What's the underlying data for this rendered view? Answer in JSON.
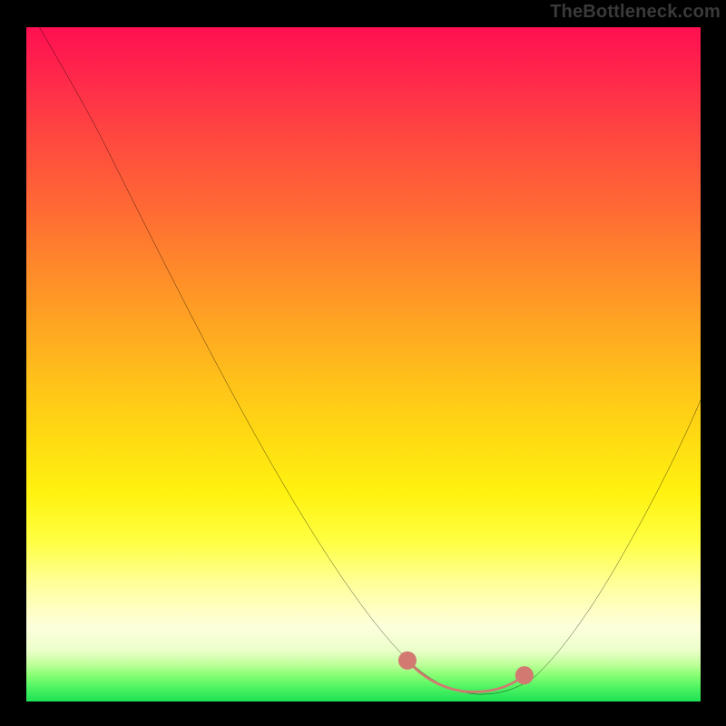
{
  "watermark": "TheBottleneck.com",
  "colors": {
    "page_background": "#000000",
    "curve_stroke": "#000000",
    "optimal_marker": "#d27a72",
    "gradient_top": "#ff0f51",
    "gradient_bottom": "#1ee155"
  },
  "chart_data": {
    "type": "line",
    "title": "",
    "xlabel": "",
    "ylabel": "",
    "xlim": [
      0,
      100
    ],
    "ylim": [
      0,
      100
    ],
    "series": [
      {
        "name": "bottleneck-curve",
        "x": [
          2,
          5,
          10,
          15,
          20,
          25,
          30,
          35,
          40,
          45,
          50,
          55,
          58,
          60,
          62,
          64,
          66,
          68,
          70,
          72,
          75,
          78,
          82,
          86,
          90,
          94,
          98,
          100
        ],
        "y": [
          100,
          95,
          86,
          78,
          70,
          62,
          54,
          46,
          38,
          30,
          22,
          13,
          8,
          5,
          3,
          2,
          1.5,
          1.2,
          1.2,
          1.5,
          3,
          6,
          11,
          18,
          26,
          34,
          42,
          46
        ]
      }
    ],
    "optimal_region": {
      "name": "optimal-band",
      "x": [
        57,
        60,
        63,
        66,
        69,
        72,
        74
      ],
      "y": [
        6,
        3.2,
        2.2,
        1.7,
        1.7,
        2.4,
        4.2
      ]
    }
  }
}
